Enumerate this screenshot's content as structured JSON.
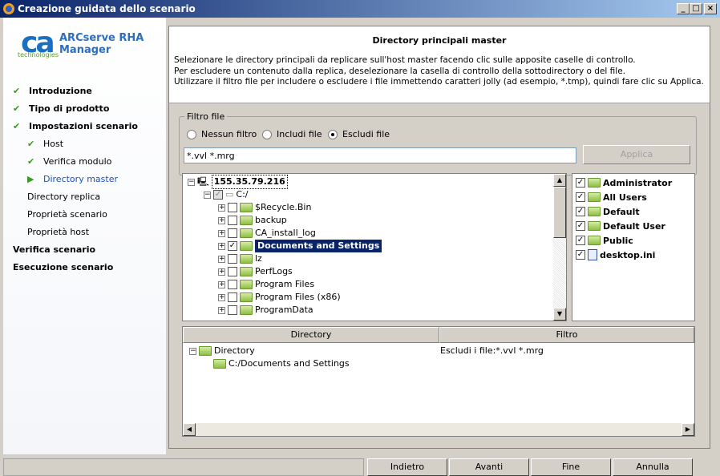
{
  "window": {
    "title": "Creazione guidata dello scenario"
  },
  "brand": {
    "logo": "ca",
    "logo_sub": "technologies",
    "product": "ARCserve RHA Manager"
  },
  "steps": [
    {
      "label": "Introduzione",
      "done": true
    },
    {
      "label": "Tipo di prodotto",
      "done": true
    },
    {
      "label": "Impostazioni scenario",
      "done": true
    },
    {
      "label": "Host",
      "done": true
    },
    {
      "label": "Verifica modulo",
      "done": true
    },
    {
      "label": "Directory master",
      "current": true
    },
    {
      "label": "Directory replica"
    },
    {
      "label": "Proprietà scenario"
    },
    {
      "label": "Proprietà host"
    },
    {
      "label": "Verifica scenario"
    },
    {
      "label": "Esecuzione scenario"
    }
  ],
  "header": {
    "title": "Directory principali master",
    "lines": [
      "Selezionare le directory principali da replicare sull'host master facendo clic sulle apposite caselle di controllo.",
      "Per escludere un contenuto dalla replica, deselezionare la casella di controllo della sottodirectory o del file.",
      "Utilizzare il filtro file per includere o escludere i file immettendo caratteri jolly (ad esempio, *.tmp), quindi fare clic su Applica."
    ]
  },
  "filter": {
    "legend": "Filtro file",
    "options": [
      "Nessun filtro",
      "Includi file",
      "Escludi file"
    ],
    "selected": "Escludi file",
    "value": "*.vvl *.mrg",
    "apply": "Applica"
  },
  "tree": {
    "host": "155.35.79.216",
    "drive": "C:/",
    "folders": [
      {
        "name": "$Recycle.Bin",
        "checked": false
      },
      {
        "name": "backup",
        "checked": false
      },
      {
        "name": "CA_install_log",
        "checked": false
      },
      {
        "name": "Documents and Settings",
        "checked": true,
        "selected": true
      },
      {
        "name": "lz",
        "checked": false
      },
      {
        "name": "PerfLogs",
        "checked": false
      },
      {
        "name": "Program Files",
        "checked": false
      },
      {
        "name": "Program Files (x86)",
        "checked": false
      },
      {
        "name": "ProgramData",
        "checked": false
      }
    ]
  },
  "files": [
    {
      "name": "Administrator",
      "type": "folder"
    },
    {
      "name": "All Users",
      "type": "folder"
    },
    {
      "name": "Default",
      "type": "folder"
    },
    {
      "name": "Default User",
      "type": "folder"
    },
    {
      "name": "Public",
      "type": "folder"
    },
    {
      "name": "desktop.ini",
      "type": "file"
    }
  ],
  "table": {
    "columns": [
      "Directory",
      "Filtro"
    ],
    "root": "Directory",
    "root_filter": "Escludi i file:*.vvl *.mrg",
    "child": "C:/Documents and Settings"
  },
  "footer": {
    "back": "Indietro",
    "next": "Avanti",
    "finish": "Fine",
    "cancel": "Annulla"
  }
}
